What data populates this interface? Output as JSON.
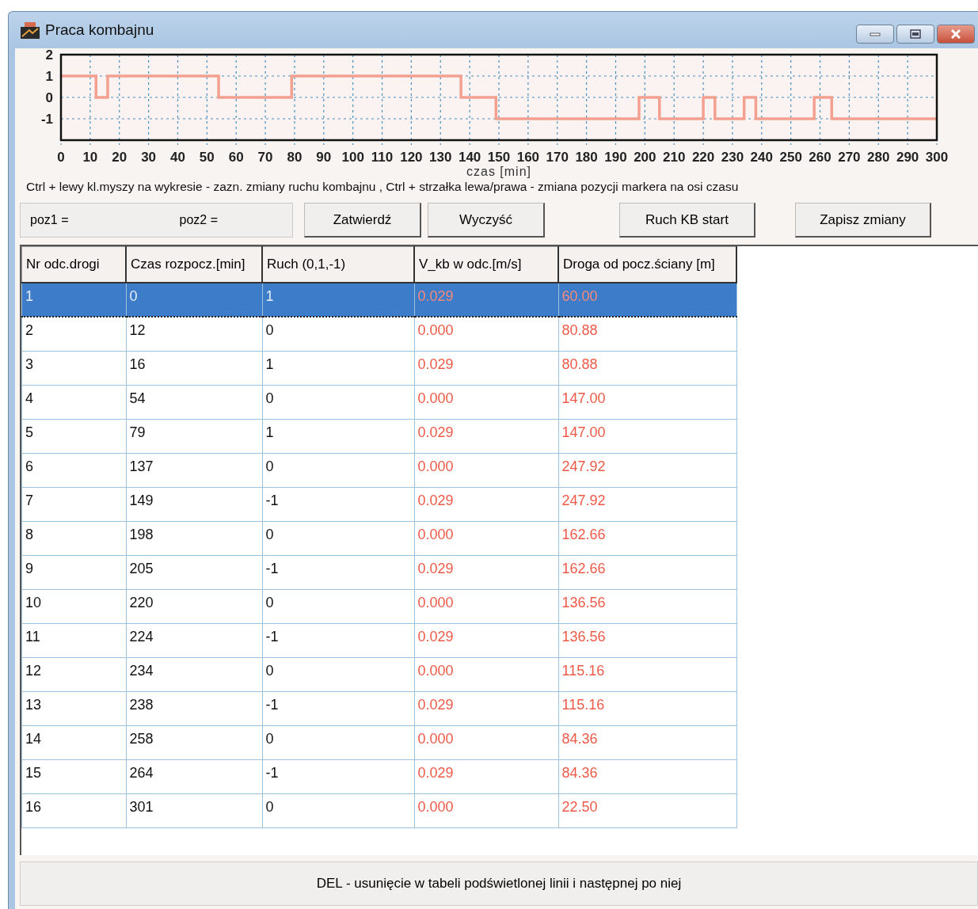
{
  "window": {
    "title": "Praca kombajnu",
    "buttons": [
      {
        "kind": "minimize"
      },
      {
        "kind": "maximize"
      },
      {
        "kind": "close"
      }
    ]
  },
  "chart": {
    "chart_data": {
      "type": "line",
      "xlabel": "czas [min]",
      "xlim": [
        0,
        300
      ],
      "ylim": [
        -2,
        2
      ],
      "xticks": [
        0,
        10,
        20,
        30,
        40,
        50,
        60,
        70,
        80,
        90,
        100,
        110,
        120,
        130,
        140,
        150,
        160,
        170,
        180,
        190,
        200,
        210,
        220,
        230,
        240,
        250,
        260,
        270,
        280,
        290,
        300
      ],
      "yticks": [
        -1,
        0,
        1,
        2
      ],
      "grid": true,
      "x": [
        0,
        12,
        12,
        16,
        16,
        54,
        54,
        79,
        79,
        137,
        137,
        149,
        149,
        198,
        198,
        205,
        205,
        220,
        220,
        224,
        224,
        234,
        234,
        238,
        238,
        258,
        258,
        264,
        264,
        300
      ],
      "series": [
        {
          "color": "#f4a090",
          "values": [
            1,
            1,
            0,
            0,
            1,
            1,
            0,
            0,
            1,
            1,
            0,
            0,
            -1,
            -1,
            0,
            0,
            -1,
            -1,
            0,
            0,
            -1,
            -1,
            0,
            0,
            -1,
            -1,
            0,
            0,
            -1,
            -1
          ]
        }
      ]
    }
  },
  "hint": "Ctrl + lewy kl.myszy na wykresie - zazn. zmiany ruchu kombajnu , Ctrl + strzałka lewa/prawa - zmiana pozycji markera na osi czasu",
  "positions": [
    {
      "label": "poz1 ="
    },
    {
      "label": "poz2 ="
    }
  ],
  "buttons": [
    "Zatwierdź",
    "Wyczyść",
    "Ruch KB start",
    "Zapisz zmiany"
  ],
  "table": {
    "columns": [
      "Nr odc.drogi",
      "Czas rozpocz.[min]",
      "Ruch (0,1,-1)",
      "V_kb w odc.[m/s]",
      "Droga od pocz.ściany [m]"
    ],
    "rows": [
      {
        "selected": true,
        "cells": [
          "1",
          "0",
          "1",
          "0.029",
          "60.00"
        ]
      },
      {
        "selected": false,
        "cells": [
          "2",
          "12",
          "0",
          "0.000",
          "80.88"
        ]
      },
      {
        "selected": false,
        "cells": [
          "3",
          "16",
          "1",
          "0.029",
          "80.88"
        ]
      },
      {
        "selected": false,
        "cells": [
          "4",
          "54",
          "0",
          "0.000",
          "147.00"
        ]
      },
      {
        "selected": false,
        "cells": [
          "5",
          "79",
          "1",
          "0.029",
          "147.00"
        ]
      },
      {
        "selected": false,
        "cells": [
          "6",
          "137",
          "0",
          "0.000",
          "247.92"
        ]
      },
      {
        "selected": false,
        "cells": [
          "7",
          "149",
          "-1",
          "0.029",
          "247.92"
        ]
      },
      {
        "selected": false,
        "cells": [
          "8",
          "198",
          "0",
          "0.000",
          "162.66"
        ]
      },
      {
        "selected": false,
        "cells": [
          "9",
          "205",
          "-1",
          "0.029",
          "162.66"
        ]
      },
      {
        "selected": false,
        "cells": [
          "10",
          "220",
          "0",
          "0.000",
          "136.56"
        ]
      },
      {
        "selected": false,
        "cells": [
          "11",
          "224",
          "-1",
          "0.029",
          "136.56"
        ]
      },
      {
        "selected": false,
        "cells": [
          "12",
          "234",
          "0",
          "0.000",
          "115.16"
        ]
      },
      {
        "selected": false,
        "cells": [
          "13",
          "238",
          "-1",
          "0.029",
          "115.16"
        ]
      },
      {
        "selected": false,
        "cells": [
          "14",
          "258",
          "0",
          "0.000",
          "84.36"
        ]
      },
      {
        "selected": false,
        "cells": [
          "15",
          "264",
          "-1",
          "0.029",
          "84.36"
        ]
      },
      {
        "selected": false,
        "cells": [
          "16",
          "301",
          "0",
          "0.000",
          "22.50"
        ]
      }
    ]
  },
  "status_bar": "DEL - usunięcie w tabeli podświetlonej linii i następnej po niej"
}
